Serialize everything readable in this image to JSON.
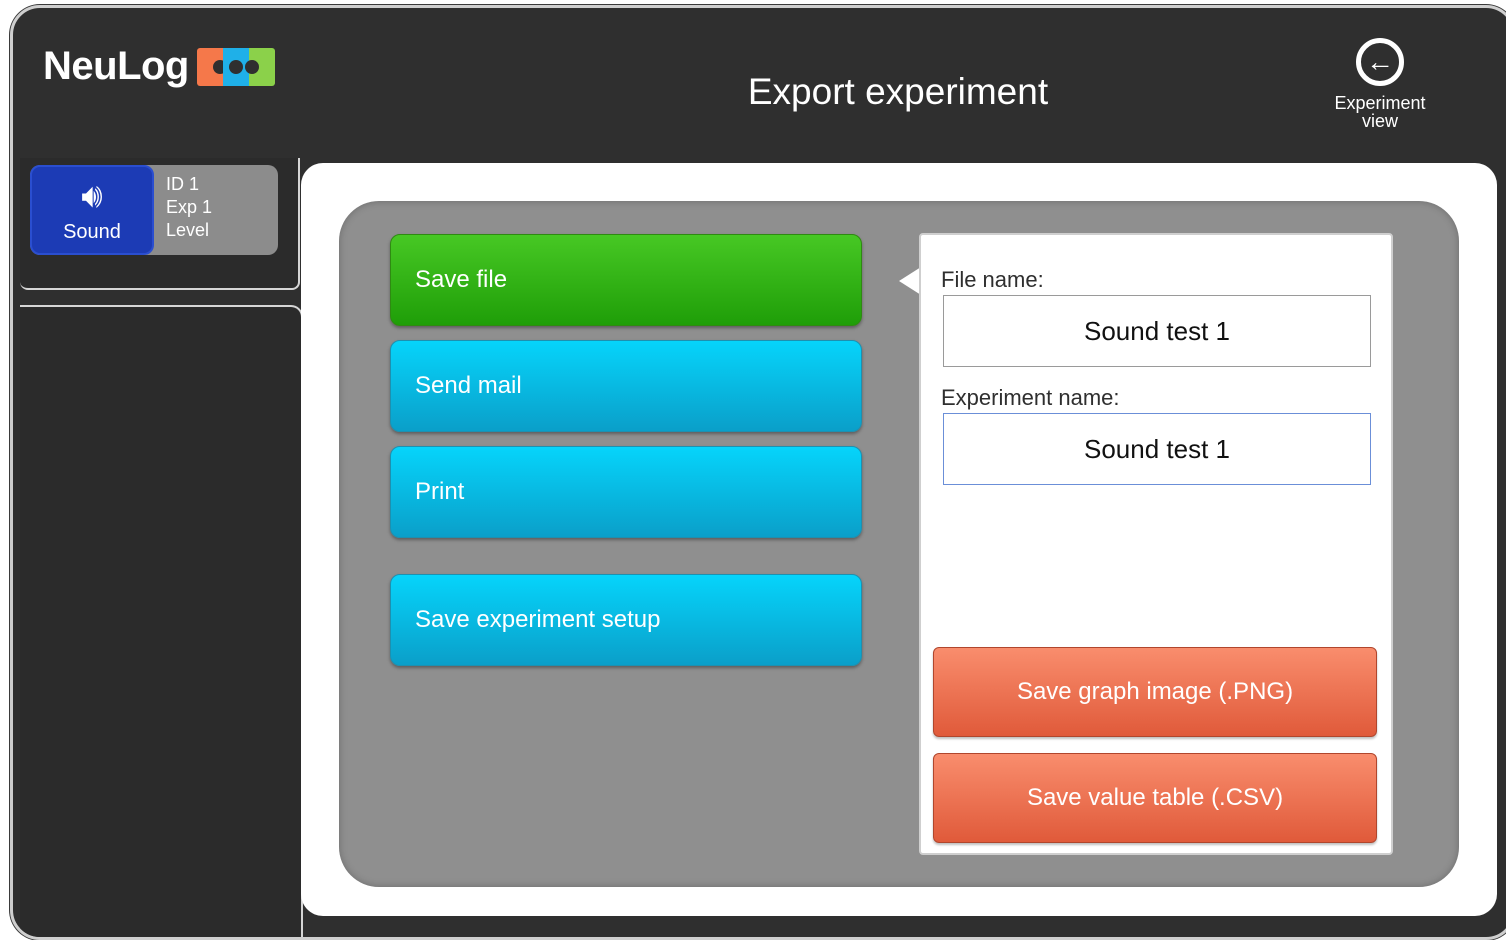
{
  "header": {
    "logo_text": "NeuLog",
    "title": "Export experiment",
    "nav_button": {
      "icon": "arrow-left-circle-icon",
      "label": "Experiment\nview"
    }
  },
  "sensor": {
    "name": "Sound",
    "icon": "speaker-icon",
    "id_line": "ID 1",
    "exp_line": "Exp 1",
    "mode_line": "Level",
    "color": "#1c3bb5"
  },
  "menu": {
    "items": [
      {
        "label": "Save file",
        "active": true
      },
      {
        "label": "Send mail",
        "active": false
      },
      {
        "label": "Print",
        "active": false
      },
      {
        "label": "Save experiment setup",
        "active": false
      }
    ]
  },
  "form": {
    "file_name_label": "File name:",
    "file_name_value": "Sound test 1",
    "experiment_name_label": "Experiment name:",
    "experiment_name_value": "Sound test 1",
    "save_png_label": "Save graph image (.PNG)",
    "save_csv_label": "Save value table (.CSV)"
  },
  "colors": {
    "active_menu": "#1f9e08",
    "menu": "#06c2ee",
    "action": "#e8664a",
    "background": "#2f2f2f"
  }
}
